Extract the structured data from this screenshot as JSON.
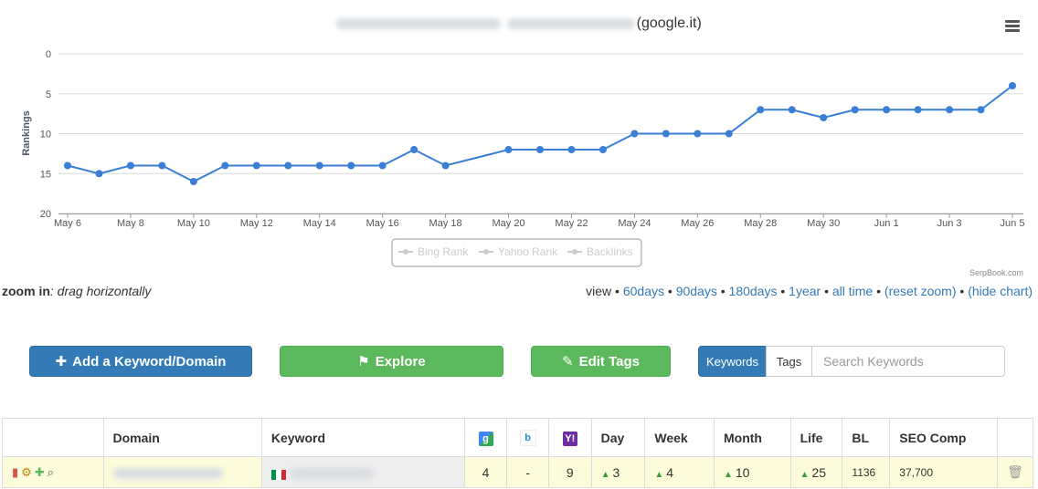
{
  "chart": {
    "title_suffix": "(google.it)",
    "credit": "SerpBook.com",
    "legend": [
      "Bing Rank",
      "Yahoo Rank",
      "Backlinks"
    ]
  },
  "chart_data": {
    "type": "line",
    "ylabel": "Rankings",
    "ylim": [
      0,
      20
    ],
    "y_reversed": true,
    "y_ticks": [
      0,
      5,
      10,
      15,
      20
    ],
    "x_tick_labels": [
      "May 6",
      "May 8",
      "May 10",
      "May 12",
      "May 14",
      "May 16",
      "May 18",
      "May 20",
      "May 22",
      "May 24",
      "May 26",
      "May 28",
      "May 30",
      "Jun 1",
      "Jun 3",
      "Jun 5"
    ],
    "x": [
      "May 6",
      "May 7",
      "May 8",
      "May 9",
      "May 10",
      "May 11",
      "May 12",
      "May 13",
      "May 14",
      "May 15",
      "May 16",
      "May 17",
      "May 18",
      "May 20",
      "May 21",
      "May 22",
      "May 23",
      "May 24",
      "May 25",
      "May 26",
      "May 27",
      "May 28",
      "May 29",
      "May 30",
      "May 31",
      "Jun 1",
      "Jun 2",
      "Jun 3",
      "Jun 4",
      "Jun 5"
    ],
    "series": [
      {
        "values": [
          14,
          15,
          14,
          14,
          16,
          14,
          14,
          14,
          14,
          14,
          14,
          12,
          14,
          12,
          12,
          12,
          12,
          10,
          10,
          10,
          10,
          7,
          7,
          8,
          7,
          7,
          7,
          7,
          7,
          4
        ],
        "color": "#3a7fd5"
      }
    ],
    "grid": true,
    "legend_position": "bottom-center"
  },
  "zoom": {
    "label": "zoom in",
    "hint": ": drag horizontally",
    "view_label": "view",
    "sep": "•",
    "links": [
      "60days",
      "90days",
      "180days",
      "1year",
      "all time",
      "(reset zoom)",
      "(hide chart)"
    ]
  },
  "toolbar": {
    "add_label": "Add a Keyword/Domain",
    "explore_label": "Explore",
    "edit_tags_label": "Edit Tags",
    "keywords_tab": "Keywords",
    "tags_tab": "Tags",
    "search_placeholder": "Search Keywords"
  },
  "table": {
    "headers": {
      "domain": "Domain",
      "keyword": "Keyword",
      "day": "Day",
      "week": "Week",
      "month": "Month",
      "life": "Life",
      "bl": "BL",
      "seo": "SEO Comp"
    },
    "engine_icons": [
      "google-icon",
      "bing-icon",
      "yahoo-icon"
    ],
    "row": {
      "google": "4",
      "bing": "-",
      "yahoo": "9",
      "day": "3",
      "week": "4",
      "month": "10",
      "life": "25",
      "bl": "1136",
      "seo": "37,700"
    }
  },
  "colors": {
    "primary": "#337ab7",
    "success": "#5cb85c",
    "line": "#3a7fd5",
    "row_highlight": "#fcfcdb"
  }
}
